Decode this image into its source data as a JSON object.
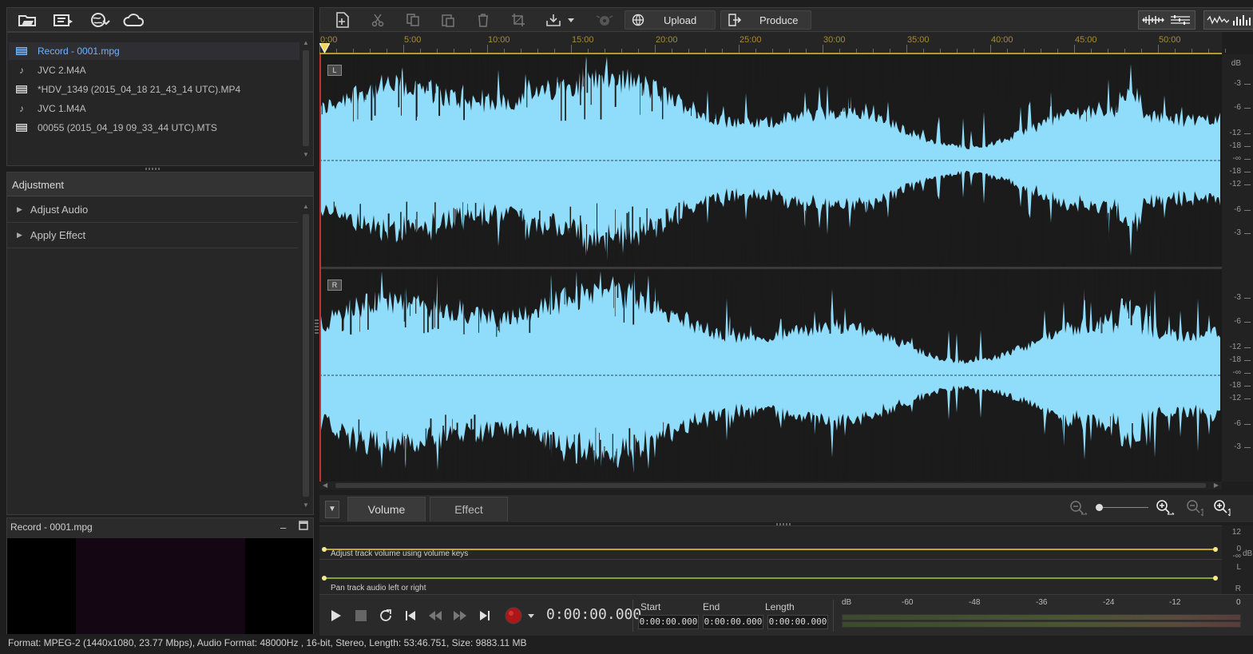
{
  "left_toolbar": {
    "icons": [
      "import-media-icon",
      "export-icon",
      "download-web-icon",
      "cloud-icon"
    ]
  },
  "media_library": {
    "items": [
      {
        "name": "Record - 0001.mpg",
        "type": "video",
        "selected": true
      },
      {
        "name": "JVC 2.M4A",
        "type": "audio",
        "selected": false
      },
      {
        "name": "*HDV_1349 (2015_04_18 21_43_14 UTC).MP4",
        "type": "video",
        "selected": false
      },
      {
        "name": "JVC 1.M4A",
        "type": "audio",
        "selected": false
      },
      {
        "name": "00055 (2015_04_19 09_33_44 UTC).MTS",
        "type": "video",
        "selected": false
      }
    ]
  },
  "adjustment": {
    "title": "Adjustment",
    "items": [
      {
        "label": "Adjust Audio"
      },
      {
        "label": "Apply Effect"
      }
    ]
  },
  "preview": {
    "title": "Record - 0001.mpg",
    "minimize_icon": "minimize-icon",
    "maximize_icon": "maximize-icon"
  },
  "main_toolbar": {
    "icons": [
      "new-file-icon",
      "cut-icon",
      "copy-icon",
      "paste-icon",
      "delete-icon",
      "crop-icon",
      "export-dropdown-icon",
      "disc-icon"
    ],
    "upload_label": "Upload",
    "produce_label": "Produce",
    "view_icons": [
      "stereo-view-icon",
      "split-view-icon",
      "waveform-icon",
      "spectrum-icon"
    ]
  },
  "ruler": {
    "ticks": [
      "0:00",
      "5:00",
      "10:00",
      "15:00",
      "20:00",
      "25:00",
      "30:00",
      "35:00",
      "40:00",
      "45:00",
      "50:00"
    ]
  },
  "channels": {
    "left_label": "L",
    "right_label": "R",
    "wave_color": "#8fdcfb"
  },
  "db_scale": {
    "unit": "dB",
    "left_labels": [
      "-3",
      "-6",
      "-12",
      "-18",
      "-∞",
      "-18",
      "-12",
      "-6",
      "-3"
    ],
    "right_labels": [
      "-3",
      "-6",
      "-12",
      "-18",
      "-∞",
      "-18",
      "-12",
      "-6",
      "-3"
    ]
  },
  "tabs": {
    "volume": "Volume",
    "effect": "Effect"
  },
  "envelope": {
    "volume_hint": "Adjust track volume using volume keys",
    "pan_hint": "Pan track audio left or right",
    "scale_top": "12",
    "scale_zero": "0",
    "scale_unit": "dB",
    "scale_neg": "-∞",
    "scale_l": "L",
    "scale_r": "R"
  },
  "transport": {
    "timecode": "0:00:00.000",
    "start_label": "Start",
    "end_label": "End",
    "length_label": "Length",
    "start_value": "0:00:00.000",
    "end_value": "0:00:00.000",
    "length_value": "0:00:00.000",
    "record_color": "#c0171a"
  },
  "meter": {
    "labels": [
      "dB",
      "-60",
      "-48",
      "-36",
      "-24",
      "-12",
      "0"
    ]
  },
  "status_bar": {
    "text": "Format: MPEG-2 (1440x1080, 23.77 Mbps), Audio Format: 48000Hz , 16-bit, Stereo, Length: 53:46.751, Size: 9883.11 MB"
  }
}
